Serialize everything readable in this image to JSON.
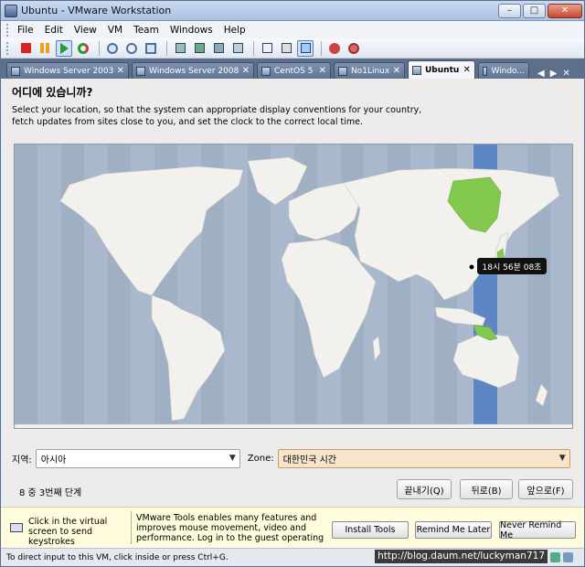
{
  "window": {
    "title": "Ubuntu - VMware Workstation"
  },
  "menus": [
    "File",
    "Edit",
    "View",
    "VM",
    "Team",
    "Windows",
    "Help"
  ],
  "tabs": [
    {
      "label": "Windows Server 2003",
      "active": false
    },
    {
      "label": "Windows Server 2008",
      "active": false
    },
    {
      "label": "CentOS 5",
      "active": false
    },
    {
      "label": "No1Linux",
      "active": false
    },
    {
      "label": "Ubuntu",
      "active": true
    },
    {
      "label": "Windo...",
      "active": false
    }
  ],
  "installer": {
    "heading": "어디에 있습니까?",
    "description": "Select your location, so that the system can appropriate display conventions for your country, fetch updates from sites close to you, and set the clock to the correct local time.",
    "tooltip": "18시 56분 08초",
    "region_label": "지역:",
    "region_value": "아시아",
    "zone_label": "Zone:",
    "zone_value": "대한민국 시간",
    "step_text": "8 중 3번째 단계",
    "quit_button": "끝내기(Q)",
    "back_button": "뒤로(B)",
    "forward_button": "앞으로(F)"
  },
  "notice": {
    "left_text": "Click in the virtual screen to send keystrokes",
    "main_text": "VMware Tools enables many features and improves mouse movement, video and performance. Log in to the guest operating",
    "install_button": "Install Tools",
    "remind_button": "Remind Me Later",
    "never_button": "Never Remind Me"
  },
  "status": {
    "text": "To direct input to this VM, click inside or press Ctrl+G.",
    "watermark": "http://blog.daum.net/luckyman717"
  },
  "colors": {
    "map_sea": "#a9b8cc",
    "land": "#f2f1ee",
    "highlight": "#84c94f",
    "zone_band": "#5f86c4"
  }
}
